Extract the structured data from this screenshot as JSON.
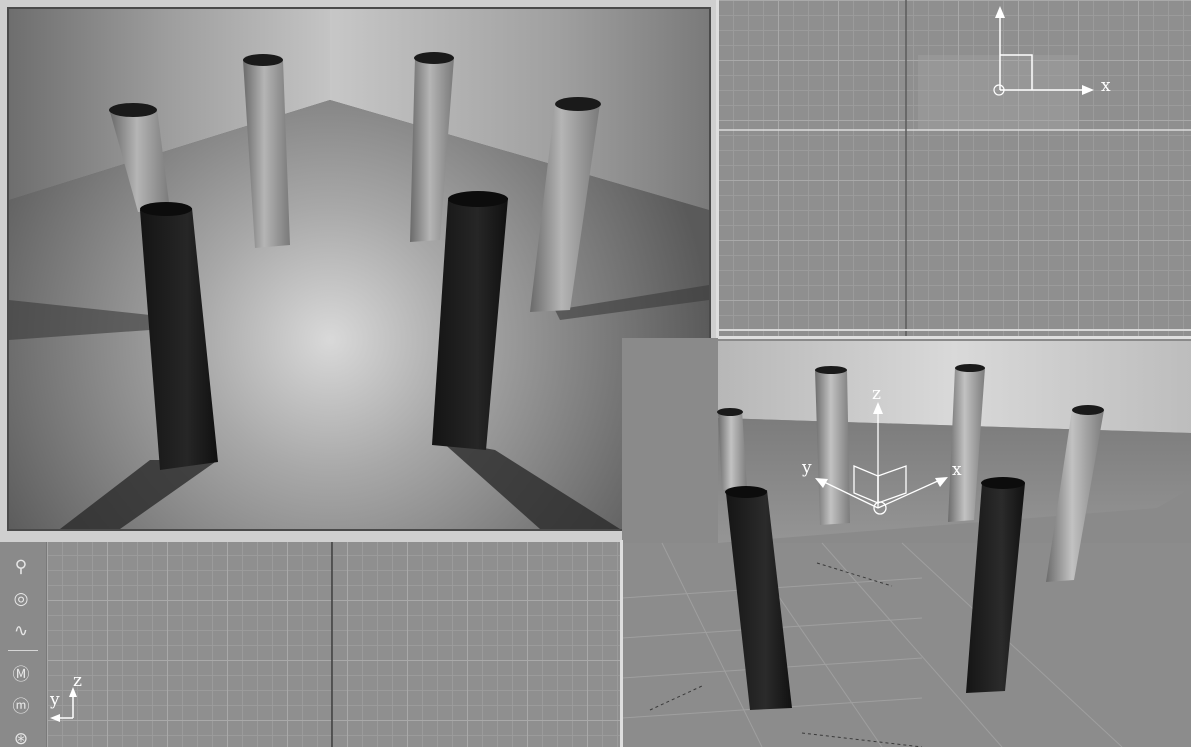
{
  "viewports": {
    "render": {
      "name": "camera-render-viewport"
    },
    "top": {
      "axis_x": "x"
    },
    "side": {
      "axis_y": "y",
      "axis_z": "z"
    },
    "perspective": {
      "axis_x": "x",
      "axis_y": "y",
      "axis_z": "z"
    }
  },
  "toolbar": {
    "icons": [
      "ik-skeleton-icon",
      "globe-icon",
      "curve-icon",
      "mesh-m-icon",
      "material-m-icon",
      "settings-circle-icon"
    ]
  },
  "colors": {
    "background": "#8e8e8e",
    "grid_line": "#a9a9a9",
    "render_frame": "#d0d0d0"
  }
}
